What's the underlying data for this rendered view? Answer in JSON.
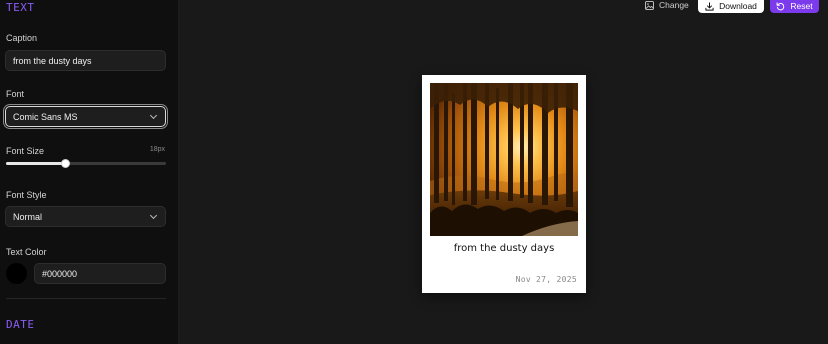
{
  "sidebar": {
    "text_section_title": "TEXT",
    "caption": {
      "label": "Caption",
      "value": "from the dusty days"
    },
    "font": {
      "label": "Font",
      "value": "Comic Sans MS"
    },
    "font_size": {
      "label": "Font Size",
      "value_text": "18px",
      "value": 18,
      "level": 0.37
    },
    "font_style": {
      "label": "Font Style",
      "value": "Normal"
    },
    "text_color": {
      "label": "Text Color",
      "value": "#000000",
      "swatch": "#000000"
    },
    "date_section_title": "DATE"
  },
  "toolbar": {
    "change_label": "Change",
    "download_label": "Download",
    "reset_label": "Reset"
  },
  "polaroid": {
    "caption": "from the dusty days",
    "date": "Nov 27, 2025"
  },
  "colors": {
    "accent": "#7c3aed",
    "section_title": "#8b5cf6",
    "background": "#191919",
    "sidebar": "#0f0f0f"
  }
}
